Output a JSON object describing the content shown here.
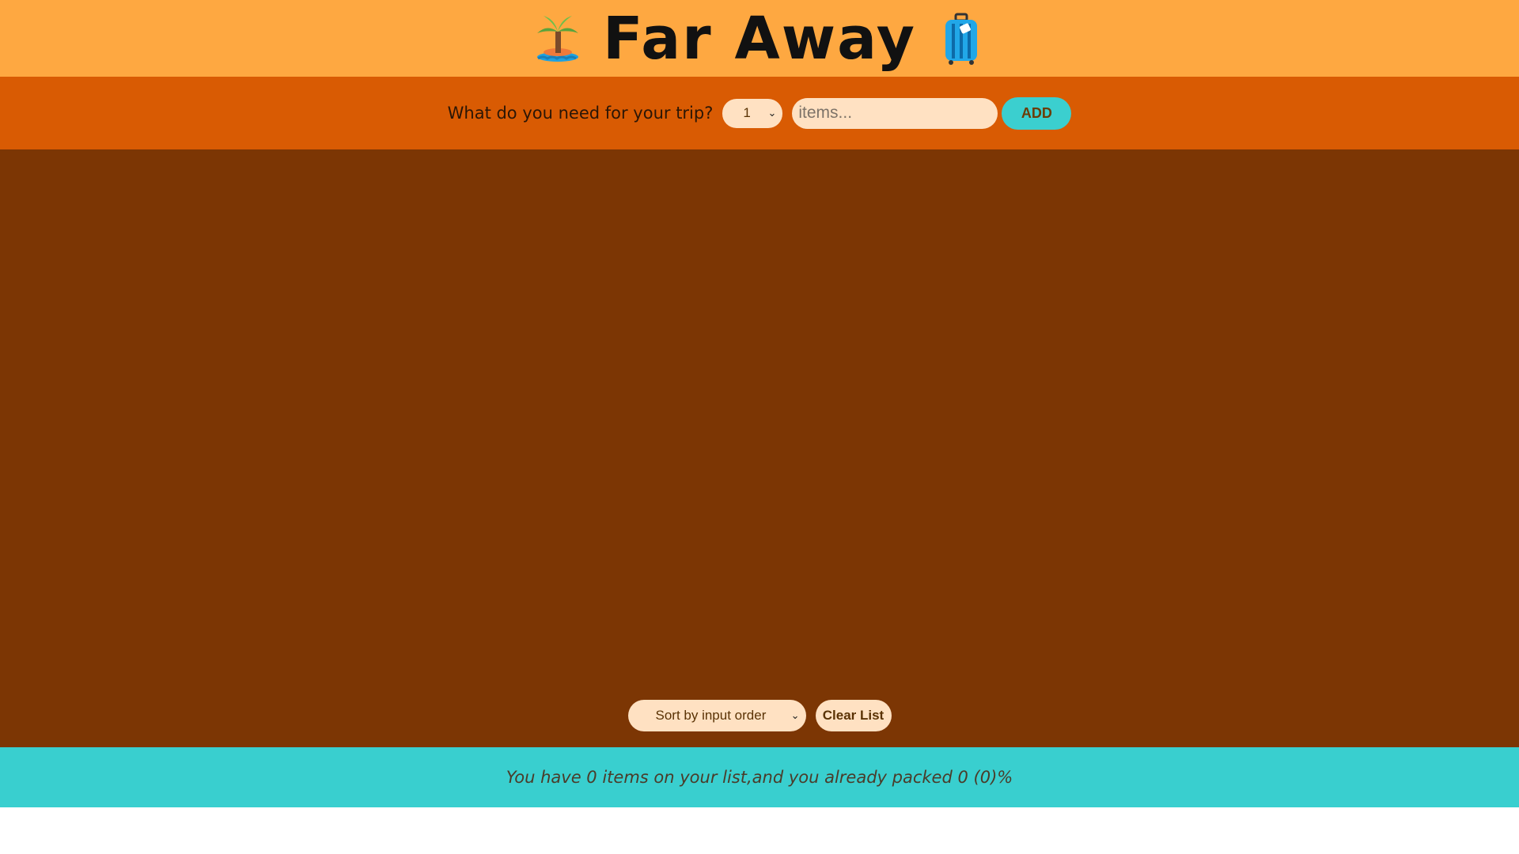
{
  "header": {
    "title": "Far Away",
    "left_icon": "palm-island-icon",
    "right_icon": "luggage-icon"
  },
  "form": {
    "prompt": "What do you need for your trip?",
    "quantity_selected": "1",
    "item_placeholder": "items...",
    "add_label": "ADD"
  },
  "list": {
    "items": [],
    "sort_selected": "Sort by input order",
    "clear_label": "Clear List"
  },
  "stats": {
    "text": "You have 0 items on your list,and you already packed 0 (0)%"
  },
  "colors": {
    "header_bg": "#fea841",
    "form_bg": "#d95b03",
    "list_bg": "#7c3604",
    "stats_bg": "#39cfcf",
    "button_accent": "#3bcfcf",
    "input_bg": "#ffe1c2"
  }
}
